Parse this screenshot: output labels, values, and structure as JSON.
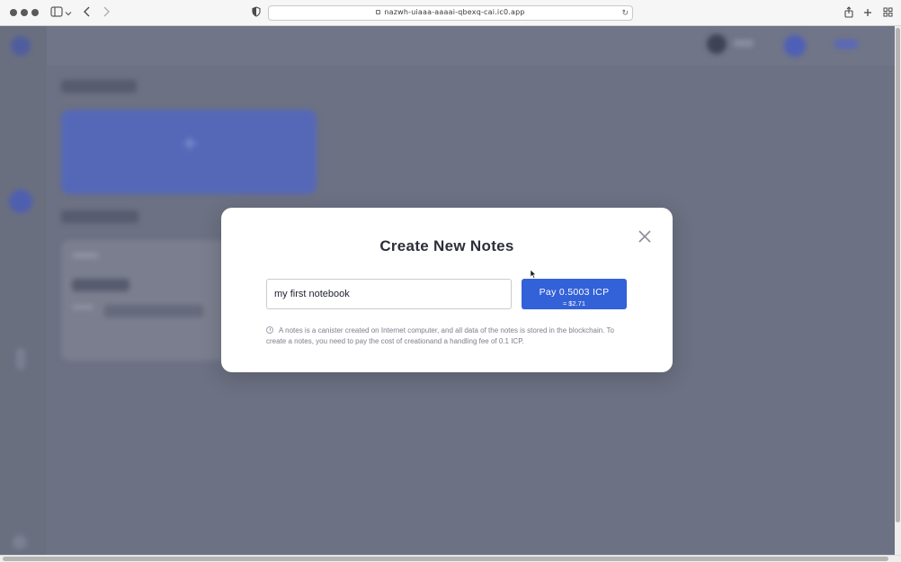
{
  "browser": {
    "url": "nazwh-uiaaa-aaaai-qbexq-cai.ic0.app",
    "icons": {
      "sidebar": "sidebar-icon",
      "back": "chevron-left-icon",
      "forward": "chevron-right-icon",
      "shield": "shield-icon",
      "reload": "reload-icon",
      "share": "share-icon",
      "new_tab": "plus-icon",
      "tabs": "tabs-grid-icon"
    }
  },
  "modal": {
    "title": "Create New Notes",
    "input_value": "my first notebook",
    "pay_button": {
      "label": "Pay 0.5003 ICP",
      "sub_label": "≈ $2.71"
    },
    "info_text": "A notes is a canister created on Internet computer, and all data of the notes is stored in the blockchain. To create a notes, you need to pay the cost of creationand a handling fee of 0.1 ICP.",
    "close_icon": "close-icon"
  },
  "colors": {
    "accent": "#3361d8",
    "overlay": "#6c7183"
  }
}
